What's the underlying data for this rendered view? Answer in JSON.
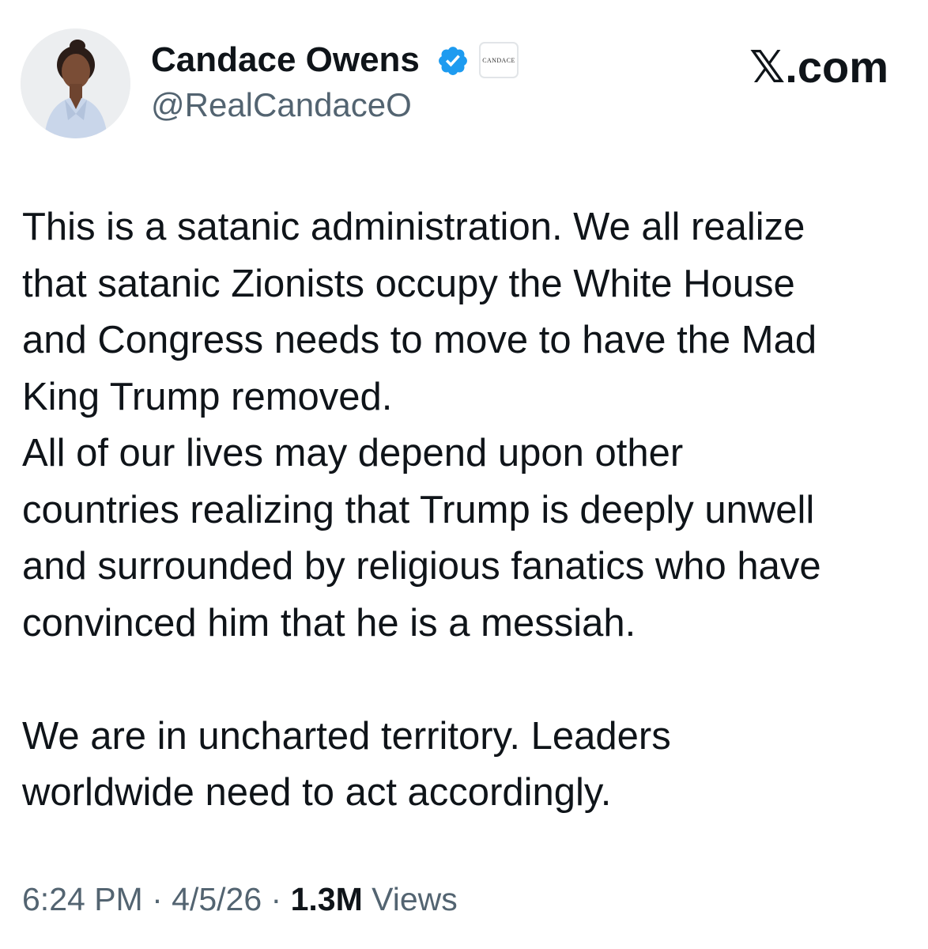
{
  "author": {
    "display_name": "Candace Owens",
    "handle": "@RealCandaceO",
    "verified_icon": "verified-badge-icon",
    "affiliate_badge_text": "CANDACE",
    "avatar_icon": "profile-photo"
  },
  "site_mark": {
    "x_symbol": "𝕏",
    "suffix": ".com"
  },
  "tweet": {
    "lines": [
      "This is a satanic administration. We all realize",
      "that satanic Zionists occupy the White House",
      "and Congress needs to move to have the Mad",
      "King Trump removed.",
      "All of our lives may depend upon other",
      "countries realizing that Trump is deeply unwell",
      "and surrounded by religious fanatics who have",
      "convinced him that he is a messiah.",
      "",
      "We are in uncharted territory. Leaders",
      "worldwide need to act accordingly."
    ]
  },
  "meta": {
    "time": "6:24 PM",
    "separator": " · ",
    "date": "4/5/26",
    "views_count": "1.3M",
    "views_label": " Views"
  },
  "colors": {
    "text": "#0f1419",
    "secondary": "#536471",
    "verified_blue": "#1d9bf0"
  }
}
